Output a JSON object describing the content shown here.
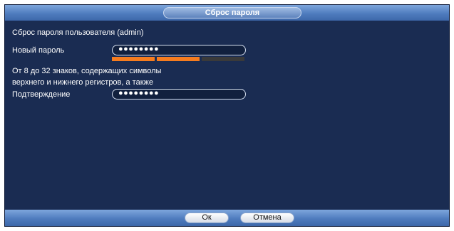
{
  "dialog": {
    "title": "Сброс пароля"
  },
  "form": {
    "heading": "Сброс пароля пользователя (admin)",
    "new_password_label": "Новый пароль",
    "new_password_value": "●●●●●●●●",
    "strength_segments_filled": 2,
    "strength_segments_total": 3,
    "hint_line1": "От 8 до 32 знаков, содержащих символы",
    "hint_line2": "верхнего и нижнего регистров, а также",
    "confirm_label": "Подтверждение",
    "confirm_value": "●●●●●●●●"
  },
  "footer": {
    "ok_label": "Ок",
    "cancel_label": "Отмена"
  },
  "colors": {
    "panel": "#1a2c52",
    "header": "#4f7cbe",
    "strength_filled": "#f57c1f",
    "strength_empty": "#3a3a3a"
  }
}
